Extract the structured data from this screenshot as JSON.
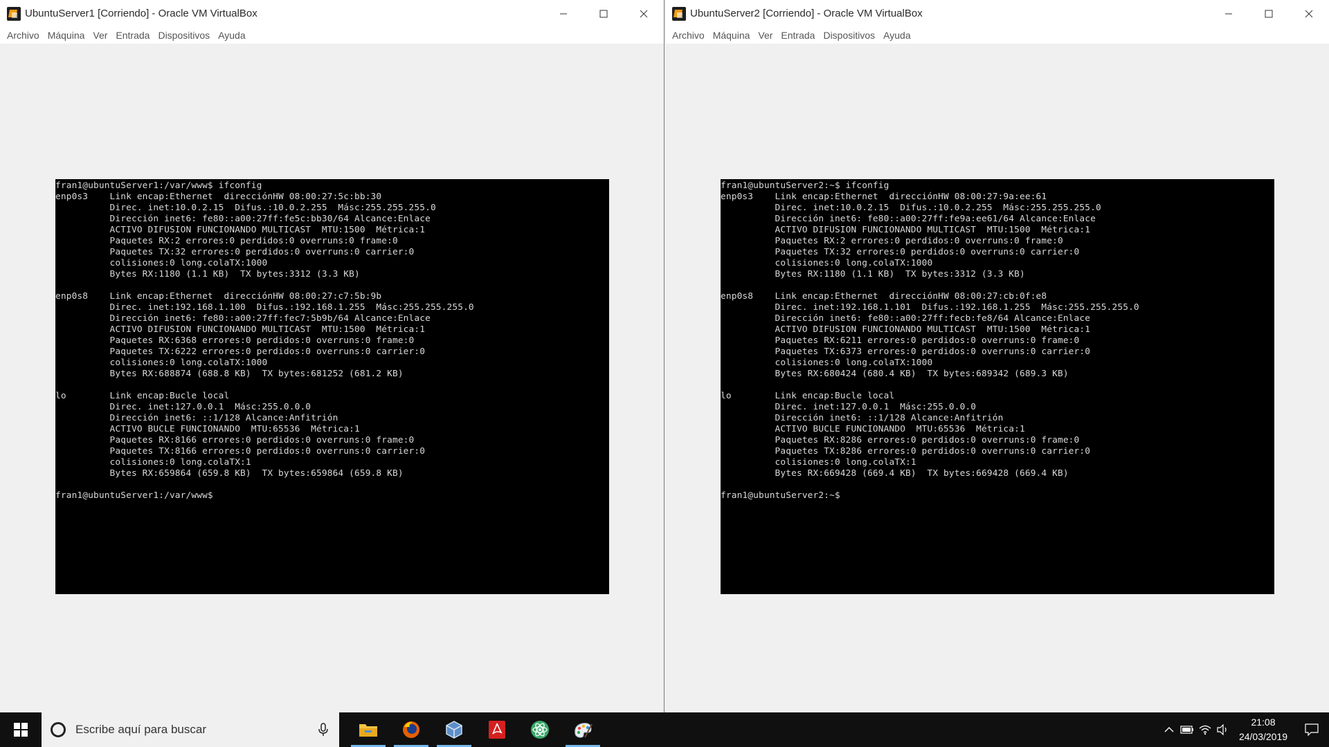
{
  "windows": [
    {
      "title": "UbuntuServer1 [Corriendo] - Oracle VM VirtualBox",
      "menu": [
        "Archivo",
        "Máquina",
        "Ver",
        "Entrada",
        "Dispositivos",
        "Ayuda"
      ],
      "console": "fran1@ubuntuServer1:/var/www$ ifconfig\nenp0s3    Link encap:Ethernet  direcciónHW 08:00:27:5c:bb:30\n          Direc. inet:10.0.2.15  Difus.:10.0.2.255  Másc:255.255.255.0\n          Dirección inet6: fe80::a00:27ff:fe5c:bb30/64 Alcance:Enlace\n          ACTIVO DIFUSION FUNCIONANDO MULTICAST  MTU:1500  Métrica:1\n          Paquetes RX:2 errores:0 perdidos:0 overruns:0 frame:0\n          Paquetes TX:32 errores:0 perdidos:0 overruns:0 carrier:0\n          colisiones:0 long.colaTX:1000\n          Bytes RX:1180 (1.1 KB)  TX bytes:3312 (3.3 KB)\n\nenp0s8    Link encap:Ethernet  direcciónHW 08:00:27:c7:5b:9b\n          Direc. inet:192.168.1.100  Difus.:192.168.1.255  Másc:255.255.255.0\n          Dirección inet6: fe80::a00:27ff:fec7:5b9b/64 Alcance:Enlace\n          ACTIVO DIFUSION FUNCIONANDO MULTICAST  MTU:1500  Métrica:1\n          Paquetes RX:6368 errores:0 perdidos:0 overruns:0 frame:0\n          Paquetes TX:6222 errores:0 perdidos:0 overruns:0 carrier:0\n          colisiones:0 long.colaTX:1000\n          Bytes RX:688874 (688.8 KB)  TX bytes:681252 (681.2 KB)\n\nlo        Link encap:Bucle local\n          Direc. inet:127.0.0.1  Másc:255.0.0.0\n          Dirección inet6: ::1/128 Alcance:Anfitrión\n          ACTIVO BUCLE FUNCIONANDO  MTU:65536  Métrica:1\n          Paquetes RX:8166 errores:0 perdidos:0 overruns:0 frame:0\n          Paquetes TX:8166 errores:0 perdidos:0 overruns:0 carrier:0\n          colisiones:0 long.colaTX:1\n          Bytes RX:659864 (659.8 KB)  TX bytes:659864 (659.8 KB)\n\nfran1@ubuntuServer1:/var/www$"
    },
    {
      "title": "UbuntuServer2 [Corriendo] - Oracle VM VirtualBox",
      "menu": [
        "Archivo",
        "Máquina",
        "Ver",
        "Entrada",
        "Dispositivos",
        "Ayuda"
      ],
      "console": "fran1@ubuntuServer2:~$ ifconfig\nenp0s3    Link encap:Ethernet  direcciónHW 08:00:27:9a:ee:61\n          Direc. inet:10.0.2.15  Difus.:10.0.2.255  Másc:255.255.255.0\n          Dirección inet6: fe80::a00:27ff:fe9a:ee61/64 Alcance:Enlace\n          ACTIVO DIFUSION FUNCIONANDO MULTICAST  MTU:1500  Métrica:1\n          Paquetes RX:2 errores:0 perdidos:0 overruns:0 frame:0\n          Paquetes TX:32 errores:0 perdidos:0 overruns:0 carrier:0\n          colisiones:0 long.colaTX:1000\n          Bytes RX:1180 (1.1 KB)  TX bytes:3312 (3.3 KB)\n\nenp0s8    Link encap:Ethernet  direcciónHW 08:00:27:cb:0f:e8\n          Direc. inet:192.168.1.101  Difus.:192.168.1.255  Másc:255.255.255.0\n          Dirección inet6: fe80::a00:27ff:fecb:fe8/64 Alcance:Enlace\n          ACTIVO DIFUSION FUNCIONANDO MULTICAST  MTU:1500  Métrica:1\n          Paquetes RX:6211 errores:0 perdidos:0 overruns:0 frame:0\n          Paquetes TX:6373 errores:0 perdidos:0 overruns:0 carrier:0\n          colisiones:0 long.colaTX:1000\n          Bytes RX:680424 (680.4 KB)  TX bytes:689342 (689.3 KB)\n\nlo        Link encap:Bucle local\n          Direc. inet:127.0.0.1  Másc:255.0.0.0\n          Dirección inet6: ::1/128 Alcance:Anfitrión\n          ACTIVO BUCLE FUNCIONANDO  MTU:65536  Métrica:1\n          Paquetes RX:8286 errores:0 perdidos:0 overruns:0 frame:0\n          Paquetes TX:8286 errores:0 perdidos:0 overruns:0 carrier:0\n          colisiones:0 long.colaTX:1\n          Bytes RX:669428 (669.4 KB)  TX bytes:669428 (669.4 KB)\n\nfran1@ubuntuServer2:~$"
    }
  ],
  "taskbar": {
    "search_placeholder": "Escribe aquí para buscar",
    "apps": [
      "file-explorer-icon",
      "firefox-icon",
      "virtualbox-icon",
      "acrobat-reader-icon",
      "atom-editor-icon",
      "paint-icon"
    ],
    "time": "21:08",
    "date": "24/03/2019"
  },
  "colors": {
    "taskbar": "#101010",
    "console_bg": "#000000",
    "console_fg": "#d8d8d8",
    "running_indicator": "#76b9ed"
  }
}
